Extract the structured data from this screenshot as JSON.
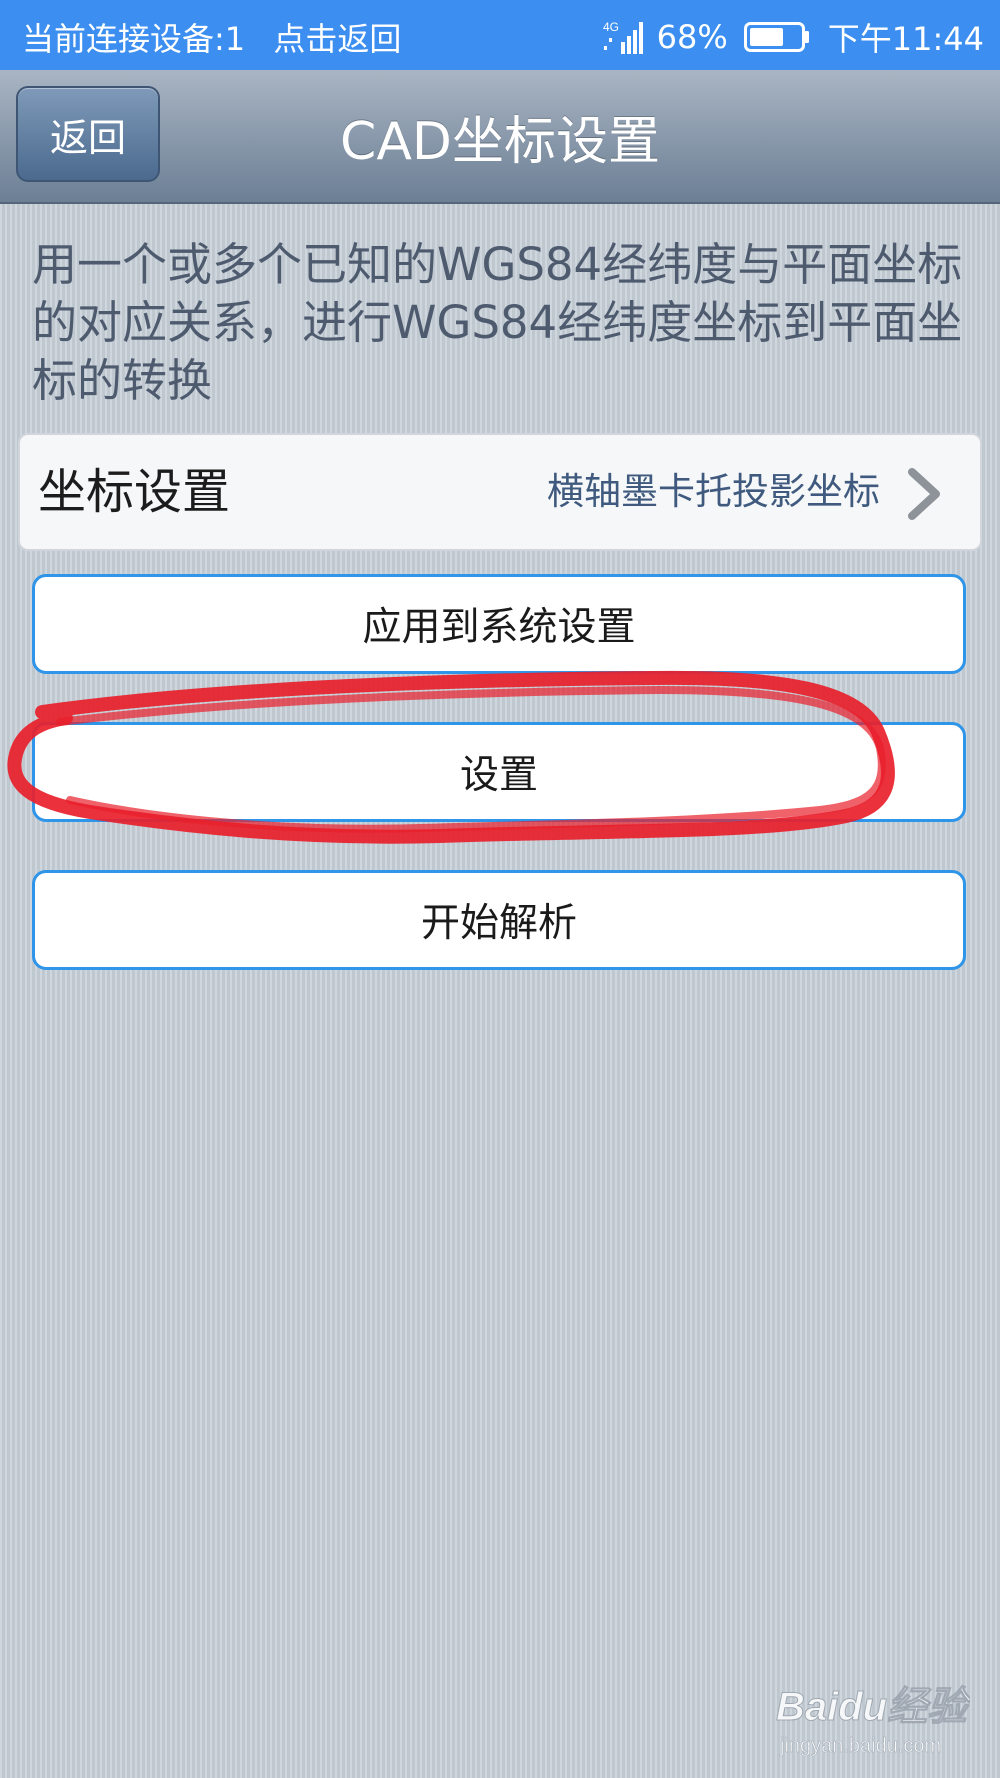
{
  "status_bar": {
    "connection_text": "当前连接设备:1",
    "back_hint": "点击返回",
    "network": "4G",
    "battery_percent": "68%",
    "battery_level": 0.68,
    "time": "下午11:44"
  },
  "header": {
    "back_label": "返回",
    "title": "CAD坐标设置"
  },
  "description": "用一个或多个已知的WGS84经纬度与平面坐标的对应关系，进行WGS84经纬度坐标到平面坐标的转换",
  "coord_setting": {
    "label": "坐标设置",
    "value": "横轴墨卡托投影坐标"
  },
  "buttons": {
    "apply": "应用到系统设置",
    "settings": "设置",
    "start": "开始解析"
  },
  "watermark": {
    "brand": "Baidu经验",
    "url": "jingyan.baidu.com"
  },
  "colors": {
    "status_bar": "#3c8ff0",
    "button_border": "#2f95e8",
    "annotation": "#e8202b"
  }
}
